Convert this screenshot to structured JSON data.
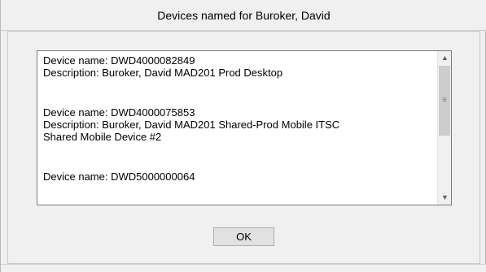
{
  "window": {
    "title": "Devices named for Buroker, David"
  },
  "devices": [
    {
      "name_line": "Device name: DWD4000082849",
      "description_lines": [
        "Description: Buroker, David MAD201 Prod Desktop"
      ]
    },
    {
      "name_line": "Device name: DWD4000075853",
      "description_lines": [
        "Description: Buroker, David MAD201 Shared-Prod Mobile ITSC",
        "Shared Mobile Device #2"
      ]
    },
    {
      "name_line": "Device name: DWD5000000064",
      "description_lines": []
    }
  ],
  "scrollbar": {
    "up_icon": "chevron-up-icon",
    "down_icon": "chevron-down-icon",
    "grip_icon": "grip-lines-icon"
  },
  "buttons": {
    "ok_label": "OK"
  }
}
